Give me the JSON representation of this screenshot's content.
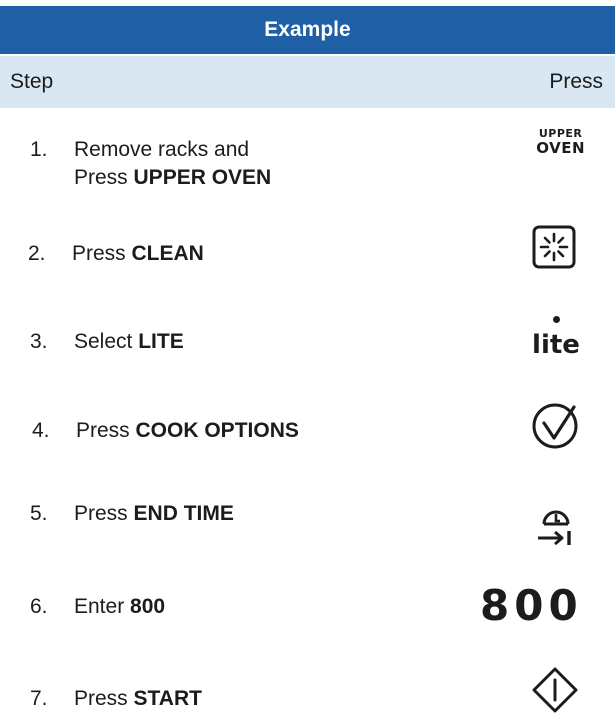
{
  "header": {
    "title": "Example"
  },
  "columns": {
    "step": "Step",
    "press": "Press"
  },
  "steps": [
    {
      "num": "1.",
      "line1": "Remove racks and",
      "line2_prefix": "Press ",
      "line2_bold": "UPPER OVEN",
      "icon": "upper-oven-key"
    },
    {
      "num": "2.",
      "prefix": "Press ",
      "bold": "CLEAN",
      "icon": "clean-icon"
    },
    {
      "num": "3.",
      "prefix": "Select ",
      "bold": "LITE",
      "icon": "lite-key"
    },
    {
      "num": "4.",
      "prefix": "Press ",
      "bold": "COOK OPTIONS",
      "icon": "cook-options-check-icon"
    },
    {
      "num": "5.",
      "prefix": "Press ",
      "bold": "END TIME",
      "icon": "end-time-clock-icon"
    },
    {
      "num": "6.",
      "prefix": "Enter ",
      "bold": "800",
      "icon": "number-display"
    },
    {
      "num": "7.",
      "prefix": "Press ",
      "bold": "START",
      "icon": "start-diamond-icon"
    }
  ],
  "keys": {
    "upper_oven_line1": "UPPER",
    "upper_oven_line2": "OVEN",
    "lite": "lite",
    "digits": "800"
  },
  "colors": {
    "header_bg": "#1f5fa5",
    "subheader_bg": "#d9e7f3"
  }
}
